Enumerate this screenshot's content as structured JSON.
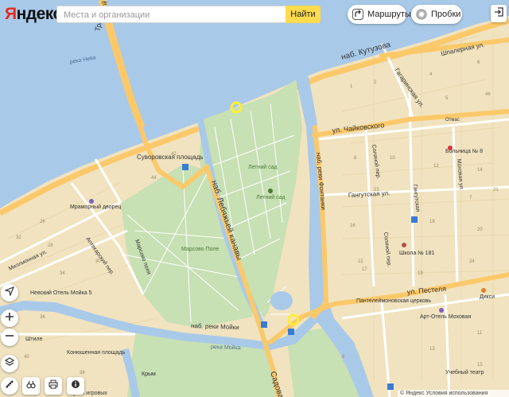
{
  "header": {
    "logo": "Яндекс",
    "search_placeholder": "Места и организации",
    "find_label": "Найти",
    "routes_label": "Маршруты",
    "traffic_label": "Пробки"
  },
  "map": {
    "streets": {
      "troitsky": "Троицкий мост",
      "kutuzova": "наб. Кутузова",
      "shpalernaya": "Шпалерная ул.",
      "gagarinskaya": "Гагаринская ул.",
      "chaikovskogo": "ул. Чайковского",
      "solyanoy": "Соляной пер.",
      "mokhovaya": "Моховая ул.",
      "gangutskaya": "Гангутская ул.",
      "gangutskaya2": "Гангутская",
      "fontanki": "наб. реки Фонтанки",
      "lebyazhey": "наб. Лебяжьей канавы",
      "moiki": "наб. реки Мойки",
      "pestelya": "ул. Пестеля",
      "millionnaya": "Миллионная ул.",
      "marsovo_polya": "Марсово поля",
      "aptekarsky": "Аптекарский пер.",
      "solyanoy2": "Соляной пер.",
      "sadovaya": "Садовая"
    },
    "labels": {
      "suvorovskaya": "Суворовская площадь",
      "letny_sad": "Летний сад",
      "letny_sad2": "Летний сад",
      "marsovo_pole": "Марсово Поле",
      "mramorny": "Мраморный дворец",
      "moika_river": "река Мойка",
      "neva_river": "река Нева",
      "konyushennaya": "Конюшенная площадь",
      "nevsky_hotel": "Невский Отель Мойка 5",
      "shtili": "Штиле",
      "muzey": "Музей игровых",
      "otrad": "Отмас",
      "bolnitsa": "Больница № 8",
      "shkola": "Школа № 181",
      "panteleimon": "Пантелеймоновская церковь",
      "art_otel": "Арт-Отель Моховая",
      "dixy": "Дикси",
      "uchebny": "Учебный театр",
      "krym": "Крым"
    },
    "house_numbers": [
      "1",
      "2",
      "4",
      "6",
      "8",
      "10",
      "12",
      "14",
      "16",
      "18",
      "20",
      "22",
      "24",
      "26",
      "28",
      "30",
      "32",
      "34",
      "36",
      "38",
      "40",
      "42",
      "44",
      "46",
      "5",
      "7",
      "9",
      "11",
      "13",
      "15",
      "17",
      "19",
      "21",
      "23"
    ]
  },
  "footer": {
    "text": "© Яндекс Условия использования"
  },
  "colors": {
    "water": "#a9c9e8",
    "block": "#f1e3c0",
    "park": "#c7e0b4",
    "road_major": "#fbc96a",
    "road_minor": "#ffffff",
    "highlight": "#ffee33"
  },
  "icons": [
    "routes-icon",
    "traffic-icon",
    "login-icon",
    "geolocation-icon",
    "zoom-in-icon",
    "zoom-out-icon",
    "layers-icon",
    "ruler-icon",
    "print-icon",
    "binoculars-icon",
    "info-icon"
  ]
}
